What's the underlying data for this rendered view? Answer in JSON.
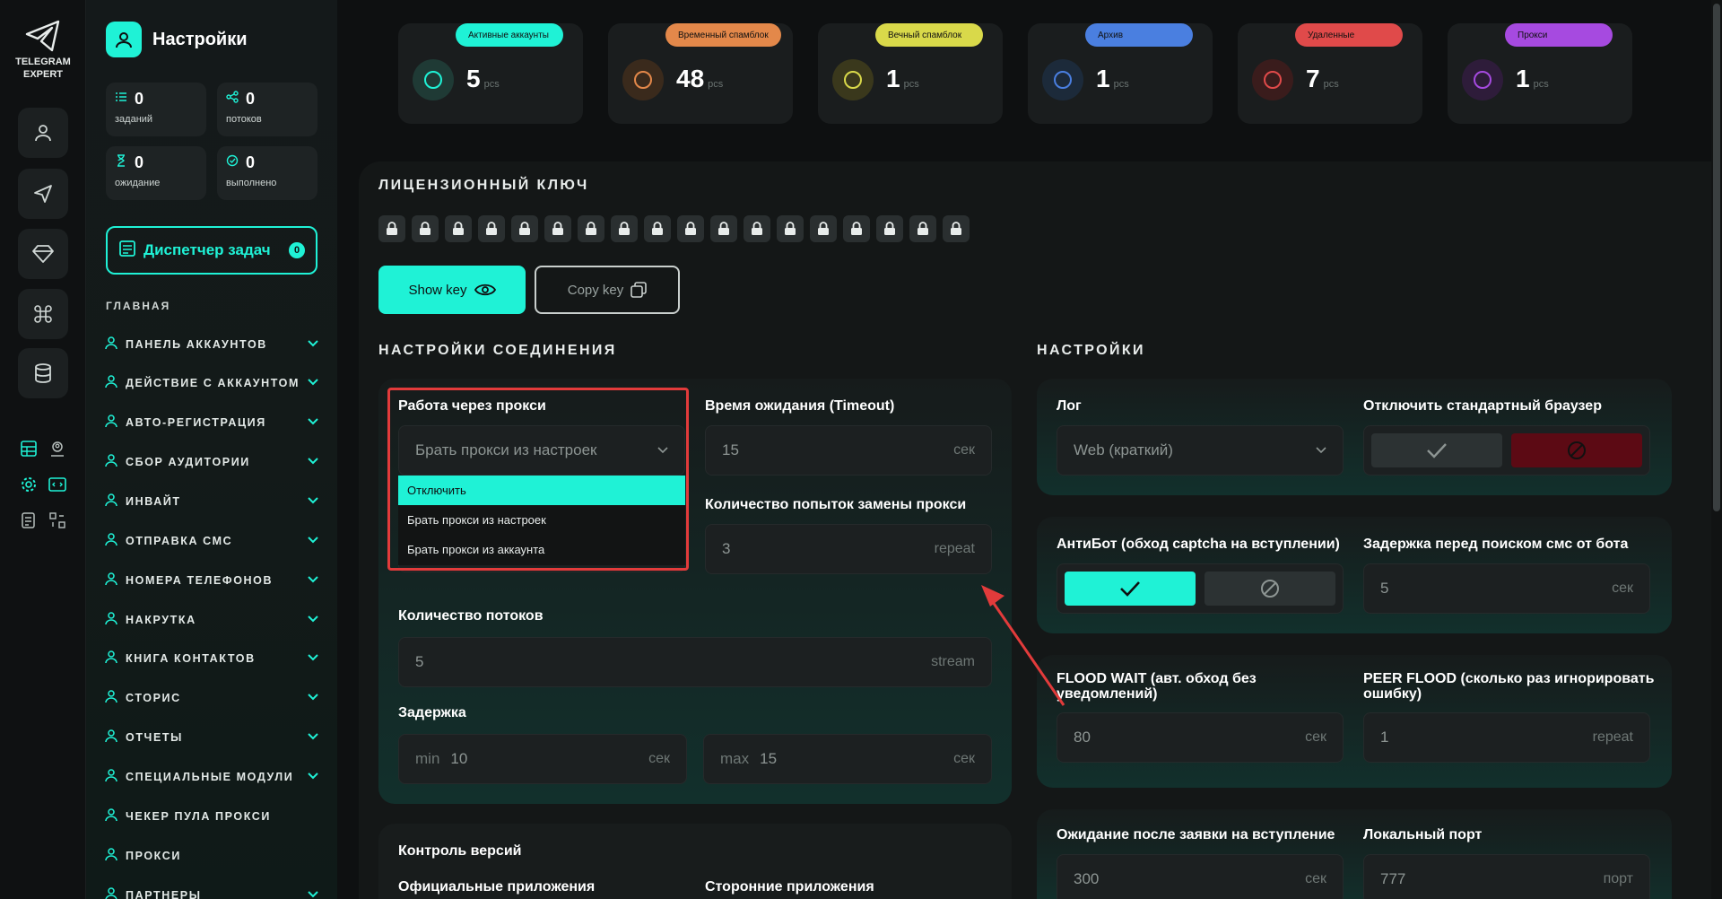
{
  "rail": {
    "logo_line1": "TELEGRAM",
    "logo_line2": "EXPERT"
  },
  "sidebar": {
    "title": "Настройки",
    "stats": [
      {
        "value": "0",
        "label": "заданий"
      },
      {
        "value": "0",
        "label": "потоков"
      },
      {
        "value": "0",
        "label": "ожидание"
      },
      {
        "value": "0",
        "label": "выполнено"
      }
    ],
    "task_manager": {
      "label": "Диспетчер задач",
      "count": "0"
    },
    "section": "ГЛАВНАЯ",
    "items": [
      {
        "label": "ПАНЕЛЬ АККАУНТОВ"
      },
      {
        "label": "ДЕЙСТВИЕ С АККАУНТОМ"
      },
      {
        "label": "АВТО-РЕГИСТРАЦИЯ"
      },
      {
        "label": "СБОР АУДИТОРИИ"
      },
      {
        "label": "ИНВАЙТ"
      },
      {
        "label": "ОТПРАВКА СМС"
      },
      {
        "label": "НОМЕРА ТЕЛЕФОНОВ"
      },
      {
        "label": "НАКРУТКА"
      },
      {
        "label": "КНИГА КОНТАКТОВ"
      },
      {
        "label": "СТОРИС"
      },
      {
        "label": "ОТЧЕТЫ"
      },
      {
        "label": "СПЕЦИАЛЬНЫЕ МОДУЛИ"
      },
      {
        "label": "ЧЕКЕР ПУЛА ПРОКСИ"
      },
      {
        "label": "ПРОКСИ"
      },
      {
        "label": "ПАРТНЕРЫ"
      }
    ]
  },
  "topcards": [
    {
      "badge": "Активные аккаунты",
      "value": "5",
      "unit": "pcs",
      "color": "#1ff2d6",
      "icon": "user-heart-icon"
    },
    {
      "badge": "Временный спамблок",
      "value": "48",
      "unit": "pcs",
      "color": "#e3884a",
      "icon": "warning-icon"
    },
    {
      "badge": "Вечный спамблок",
      "value": "1",
      "unit": "pcs",
      "color": "#d9d94a",
      "icon": "mail-block-icon"
    },
    {
      "badge": "Архив",
      "value": "1",
      "unit": "pcs",
      "color": "#4a7fe0",
      "icon": "folder-user-icon"
    },
    {
      "badge": "Удаленные",
      "value": "7",
      "unit": "pcs",
      "color": "#e04a4a",
      "icon": "user-x-icon"
    },
    {
      "badge": "Прокси",
      "value": "1",
      "unit": "pcs",
      "color": "#a64ae0",
      "icon": "proxy-icon"
    }
  ],
  "license": {
    "title": "ЛИЦЕНЗИОННЫЙ КЛЮЧ",
    "show_key": "Show key",
    "copy_key": "Copy key"
  },
  "connection": {
    "title": "НАСТРОЙКИ СОЕДИНЕНИЯ",
    "proxy_label": "Работа через прокси",
    "proxy_value": "Брать прокси из настроек",
    "proxy_options": [
      "Отключить",
      "Брать прокси из настроек",
      "Брать прокси из аккаунта"
    ],
    "timeout_label": "Время ожидания (Timeout)",
    "timeout_value": "15",
    "timeout_unit": "сек",
    "retries_label": "Количество попыток замены прокси",
    "retries_value": "3",
    "retries_unit": "repeat",
    "threads_label": "Количество потоков",
    "threads_value": "5",
    "threads_unit": "stream",
    "delay_label": "Задержка",
    "delay_min_prefix": "min",
    "delay_min": "10",
    "delay_max_prefix": "max",
    "delay_max": "15",
    "delay_unit": "сек"
  },
  "versions": {
    "title": "Контроль версий",
    "official": "Официальные приложения",
    "third_party": "Сторонние приложения"
  },
  "settings": {
    "title": "НАСТРОЙКИ",
    "log_label": "Лог",
    "log_value": "Web (краткий)",
    "browser_label": "Отключить стандартный браузер",
    "antibot_label": "АнтиБот (обход captcha на вступлении)",
    "sms_delay_label": "Задержка перед поиском смс от бота",
    "sms_delay_value": "5",
    "sms_delay_unit": "сек",
    "flood_label": "FLOOD WAIT (авт. обход без уведомлений)",
    "flood_value": "80",
    "flood_unit": "сек",
    "peer_label": "PEER FLOOD (сколько раз игнорировать ошибку)",
    "peer_value": "1",
    "peer_unit": "repeat",
    "join_wait_label": "Ожидание после заявки на вступление",
    "join_wait_value": "300",
    "join_wait_unit": "сек",
    "port_label": "Локальный порт",
    "port_value": "777",
    "port_unit": "порт"
  },
  "colors": {
    "accent": "#1ff2d6",
    "danger": "#e23b3b",
    "deny": "#5c0a14"
  }
}
